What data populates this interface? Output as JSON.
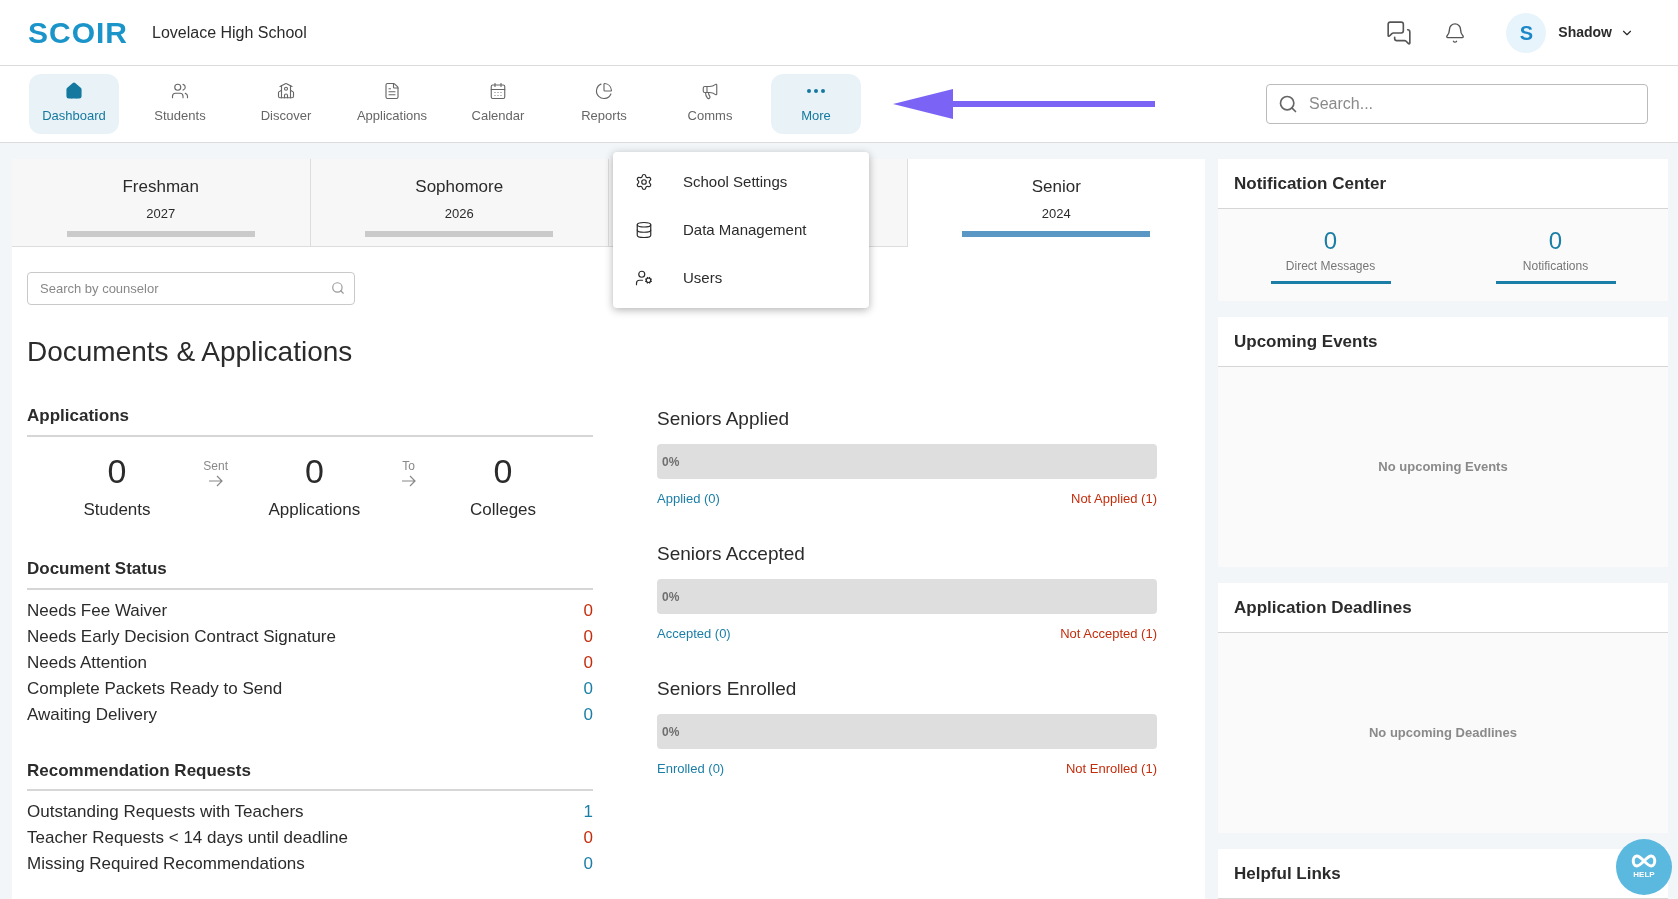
{
  "header": {
    "logo": "SCOIR",
    "school": "Lovelace High School",
    "user": {
      "initial": "S",
      "name": "Shadow"
    }
  },
  "nav": [
    {
      "label": "Dashboard",
      "selected": true
    },
    {
      "label": "Students",
      "selected": false
    },
    {
      "label": "Discover",
      "selected": false
    },
    {
      "label": "Applications",
      "selected": false
    },
    {
      "label": "Calendar",
      "selected": false
    },
    {
      "label": "Reports",
      "selected": false
    },
    {
      "label": "Comms",
      "selected": false
    },
    {
      "label": "More",
      "selected": true
    }
  ],
  "search": {
    "placeholder": "Search..."
  },
  "more_menu": [
    {
      "label": "School Settings"
    },
    {
      "label": "Data Management"
    },
    {
      "label": "Users"
    }
  ],
  "grade_tabs": [
    {
      "label": "Freshman",
      "year": "2027",
      "selected": false
    },
    {
      "label": "Sophomore",
      "year": "2026",
      "selected": false
    },
    {
      "selected": false
    },
    {
      "label": "Senior",
      "year": "2024",
      "selected": true
    }
  ],
  "counselor_search": {
    "placeholder": "Search by counselor"
  },
  "title": "Documents & Applications",
  "applications": {
    "heading": "Applications",
    "stats": [
      {
        "value": "0",
        "label": "Students"
      },
      {
        "value": "0",
        "label": "Applications"
      },
      {
        "value": "0",
        "label": "Colleges"
      }
    ],
    "connectors": [
      "Sent",
      "To"
    ]
  },
  "document_status": {
    "heading": "Document Status",
    "rows": [
      {
        "label": "Needs Fee Waiver",
        "value": "0",
        "color": "#c42d0c"
      },
      {
        "label": "Needs Early Decision Contract Signature",
        "value": "0",
        "color": "#c42d0c"
      },
      {
        "label": "Needs Attention",
        "value": "0",
        "color": "#c42d0c"
      },
      {
        "label": "Complete Packets Ready to Send",
        "value": "0",
        "color": "#1a7ea6"
      },
      {
        "label": "Awaiting Delivery",
        "value": "0",
        "color": "#1a7ea6"
      }
    ]
  },
  "recommendation_requests": {
    "heading": "Recommendation Requests",
    "rows": [
      {
        "label": "Outstanding Requests with Teachers",
        "value": "1",
        "color": "#1a7ea6"
      },
      {
        "label": "Teacher Requests < 14 days until deadline",
        "value": "0",
        "color": "#c42d0c"
      },
      {
        "label": "Missing Required Recommendations",
        "value": "0",
        "color": "#1a7ea6"
      }
    ]
  },
  "progress": [
    {
      "title": "Seniors Applied",
      "level": 0,
      "reading": "0%",
      "yes": "Applied (0)",
      "no": "Not Applied (1)"
    },
    {
      "title": "Seniors Accepted",
      "level": 0,
      "reading": "0%",
      "yes": "Accepted (0)",
      "no": "Not Accepted (1)"
    },
    {
      "title": "Seniors Enrolled",
      "level": 0,
      "reading": "0%",
      "yes": "Enrolled (0)",
      "no": "Not Enrolled (1)"
    }
  ],
  "notification_center": {
    "title": "Notification Center",
    "counters": [
      {
        "value": "0",
        "label": "Direct Messages"
      },
      {
        "value": "0",
        "label": "Notifications"
      }
    ]
  },
  "upcoming_events": {
    "title": "Upcoming Events",
    "empty": "No upcoming Events"
  },
  "application_deadlines": {
    "title": "Application Deadlines",
    "empty": "No upcoming Deadlines"
  },
  "helpful_links": {
    "title": "Helpful Links"
  },
  "help_button": {
    "label": "HELP"
  }
}
